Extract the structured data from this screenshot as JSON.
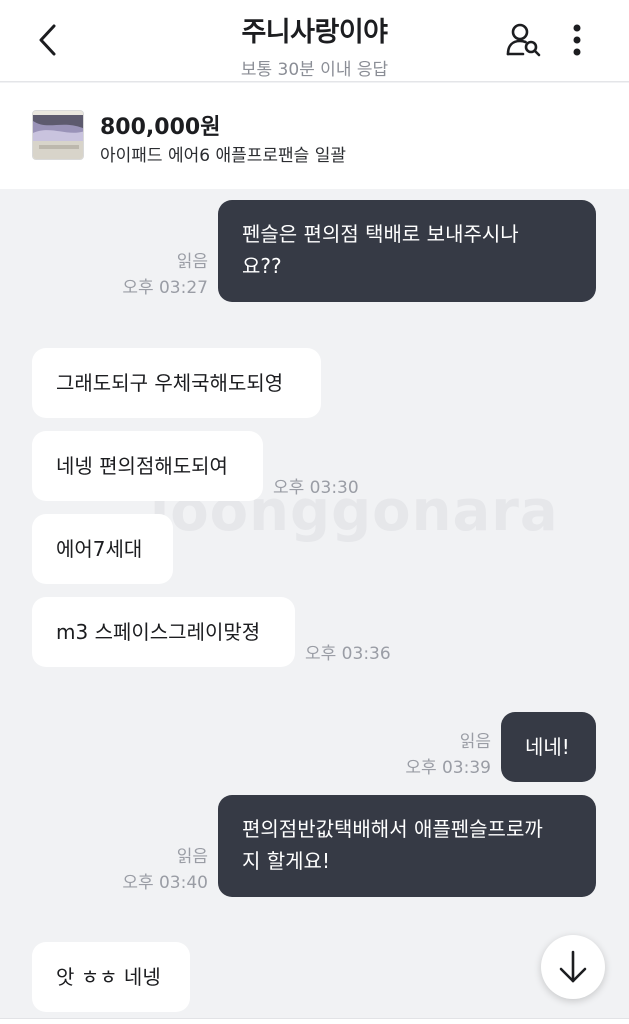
{
  "header": {
    "title": "주니사랑이야",
    "subtitle": "보통 30분 이내 응답",
    "back_icon": "chevron-left-icon",
    "profile_icon": "user-search-icon",
    "more_icon": "more-vertical-icon"
  },
  "product": {
    "price": "800,000원",
    "name": "아이패드 에어6 애플프로팬슬 일괄"
  },
  "watermark": "joonggonara",
  "messages": [
    {
      "from": "me",
      "lines": [
        "펜슬은 편의점 택배로 보내주시나",
        "요??"
      ],
      "read": "읽음",
      "time": "오후 03:27"
    },
    {
      "from": "other",
      "text": "그래도되구 우체국해도되영"
    },
    {
      "from": "other",
      "text": "네넹 편의점해도되여",
      "time": "오후 03:30"
    },
    {
      "from": "other",
      "text": "에어7세대"
    },
    {
      "from": "other",
      "text": "m3 스페이스그레이맞졍",
      "time": "오후 03:36"
    },
    {
      "from": "me",
      "text": "네네!",
      "read": "읽음",
      "time": "오후 03:39"
    },
    {
      "from": "me",
      "lines": [
        "편의점반값택배해서 애플펜슬프로까",
        "지 할게요!"
      ],
      "read": "읽음",
      "time": "오후 03:40"
    },
    {
      "from": "other",
      "text": "앗 ㅎㅎ 네넹"
    }
  ],
  "scroll_down_icon": "arrow-down-icon",
  "colors": {
    "my_bubble": "#363a45",
    "other_bubble": "#ffffff",
    "chat_background": "#f1f2f4",
    "meta_text": "#9a9da5"
  }
}
